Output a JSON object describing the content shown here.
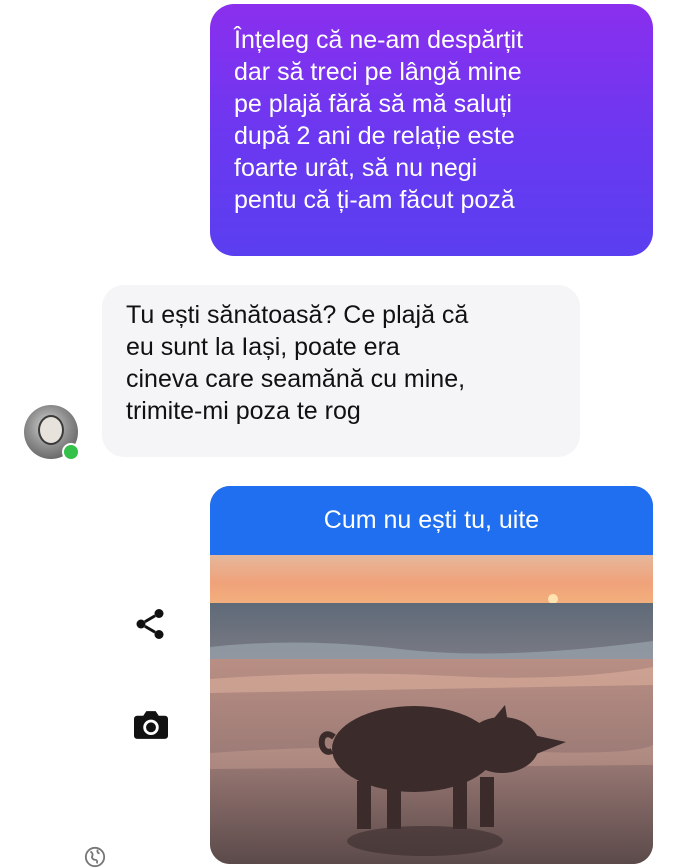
{
  "conversation": {
    "sent_message": "Înțeleg că ne-am despărțit\ndar să treci pe lângă mine\npe plajă fără să mă saluți\ndupă 2 ani de relație este\nfoarte urât, să nu negi\npentu că ți-am făcut poză",
    "received_message": "Tu ești sănătoasă? Ce plajă că\neu sunt la Iași, poate era\ncineva care seamănă cu mine,\ntrimite-mi poza te rog",
    "photo_caption": "Cum nu ești tu, uite"
  },
  "icons": {
    "share": "share-icon",
    "camera": "camera-icon",
    "globe": "globe-icon"
  },
  "colors": {
    "sent_bubble_top": "#8a2fee",
    "sent_bubble_bottom": "#5a3ff0",
    "received_bubble": "#f5f5f7",
    "caption_bar": "#1f6ff0",
    "online_indicator": "#33c14a"
  }
}
